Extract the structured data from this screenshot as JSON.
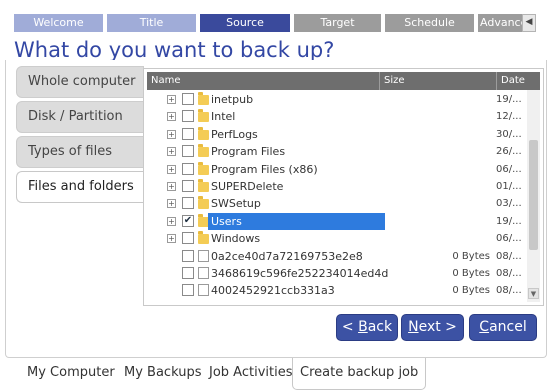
{
  "wizard": {
    "steps": [
      {
        "label": "Welcome",
        "state": "done"
      },
      {
        "label": "Title",
        "state": "done"
      },
      {
        "label": "Source",
        "state": "active"
      },
      {
        "label": "Target",
        "state": "todo"
      },
      {
        "label": "Schedule",
        "state": "todo"
      },
      {
        "label": "Advance",
        "state": "todo"
      }
    ],
    "scroll_icon": "chevron-left-icon"
  },
  "question": "What do you want to back up?",
  "options": [
    {
      "label": "Whole computer",
      "selected": false
    },
    {
      "label": "Disk / Partition",
      "selected": false
    },
    {
      "label": "Types of files",
      "selected": false
    },
    {
      "label": "Files and folders",
      "selected": true
    }
  ],
  "grid": {
    "columns": {
      "name": "Name",
      "size": "Size",
      "date": "Date"
    },
    "rows": [
      {
        "type": "folder",
        "name": "inetpub",
        "size": "",
        "date": "19/...",
        "checked": false,
        "selected": false
      },
      {
        "type": "folder",
        "name": "Intel",
        "size": "",
        "date": "12/...",
        "checked": false,
        "selected": false
      },
      {
        "type": "folder",
        "name": "PerfLogs",
        "size": "",
        "date": "30/...",
        "checked": false,
        "selected": false
      },
      {
        "type": "folder",
        "name": "Program Files",
        "size": "",
        "date": "26/...",
        "checked": false,
        "selected": false
      },
      {
        "type": "folder",
        "name": "Program Files (x86)",
        "size": "",
        "date": "06/...",
        "checked": false,
        "selected": false
      },
      {
        "type": "folder",
        "name": "SUPERDelete",
        "size": "",
        "date": "01/...",
        "checked": false,
        "selected": false
      },
      {
        "type": "folder",
        "name": "SWSetup",
        "size": "",
        "date": "03/...",
        "checked": false,
        "selected": false
      },
      {
        "type": "folder",
        "name": "Users",
        "size": "",
        "date": "19/...",
        "checked": true,
        "selected": true
      },
      {
        "type": "folder",
        "name": "Windows",
        "size": "",
        "date": "06/...",
        "checked": false,
        "selected": false
      },
      {
        "type": "file",
        "name": "0a2ce40d7a72169753e2e8",
        "size": "0 Bytes",
        "date": "08/...",
        "checked": false,
        "selected": false
      },
      {
        "type": "file",
        "name": "3468619c596fe252234014ed4d",
        "size": "0 Bytes",
        "date": "08/...",
        "checked": false,
        "selected": false
      },
      {
        "type": "file",
        "name": "4002452921ccb331a3",
        "size": "0 Bytes",
        "date": "08/...",
        "checked": false,
        "selected": false
      }
    ]
  },
  "buttons": {
    "back": {
      "prefix": "< ",
      "accel": "B",
      "rest": "ack"
    },
    "next": {
      "accel": "N",
      "rest": "ext >"
    },
    "cancel": {
      "accel": "C",
      "rest": "ancel"
    }
  },
  "bottom_tabs": [
    {
      "label": "My Computer",
      "active": false
    },
    {
      "label": "My Backups",
      "active": false
    },
    {
      "label": "Job Activities",
      "active": false
    },
    {
      "label": "Create backup job",
      "active": true
    }
  ],
  "colors": {
    "accent": "#3347a4",
    "button": "#3c52a4",
    "selection": "#2e7bde"
  }
}
